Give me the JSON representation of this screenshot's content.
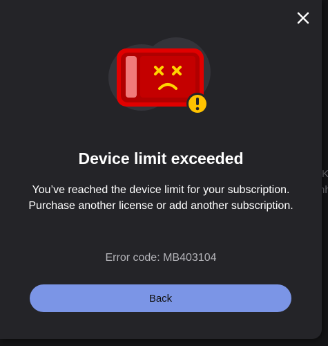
{
  "dialog": {
    "title": "Device limit exceeded",
    "message": "You’ve reached the device limit for your subscription. Purchase another license or add another subscription.",
    "error_label": "Error code:",
    "error_code": "MB403104",
    "back_label": "Back",
    "close_icon": "close-icon",
    "illustration_icon": "broken-device-icon",
    "warning_icon": "warning-icon"
  },
  "background": {
    "fragment_1": "K",
    "fragment_2": "nh"
  },
  "colors": {
    "dialog_bg": "#242428",
    "button_bg": "#7b95e6",
    "device_red": "#d40000",
    "screen_red": "#a80000",
    "face_yellow": "#ffd400",
    "warning_yellow": "#ffc300"
  }
}
